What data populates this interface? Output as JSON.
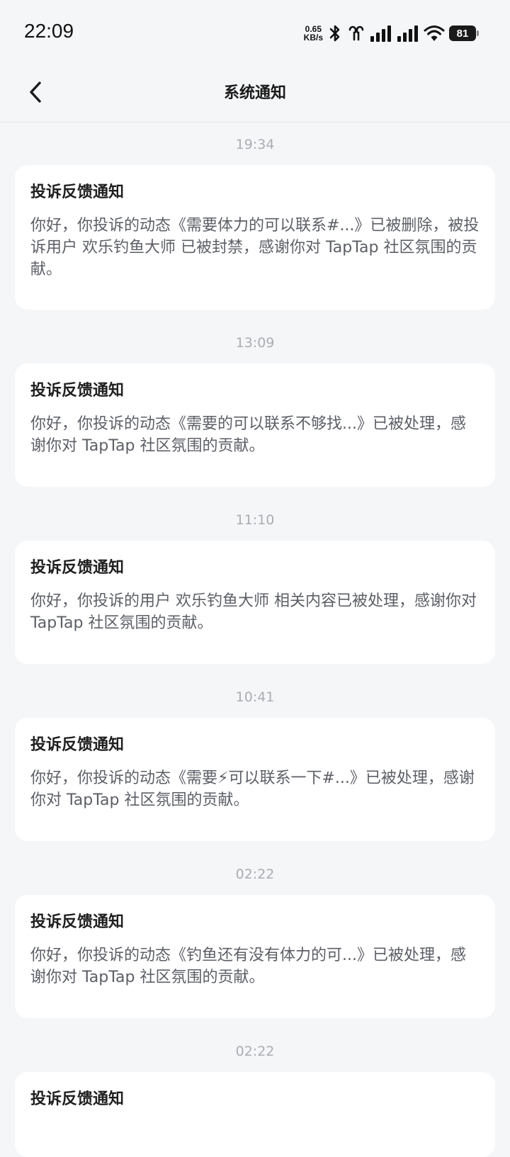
{
  "status_bar": {
    "time": "22:09",
    "net_speed_value": "0.65",
    "net_speed_unit": "KB/s",
    "battery_level": "81"
  },
  "nav": {
    "back_icon": "chevron-left-icon",
    "title": "系统通知"
  },
  "notifications": [
    {
      "time": "19:34",
      "title": "投诉反馈通知",
      "body": "你好，你投诉的动态《需要体力的可以联系#...》已被删除，被投诉用户 欢乐钓鱼大师 已被封禁，感谢你对 TapTap 社区氛围的贡献。"
    },
    {
      "time": "13:09",
      "title": "投诉反馈通知",
      "body": "你好，你投诉的动态《需要的可以联系不够找...》已被处理，感谢你对 TapTap 社区氛围的贡献。"
    },
    {
      "time": "11:10",
      "title": "投诉反馈通知",
      "body": "你好，你投诉的用户 欢乐钓鱼大师 相关内容已被处理，感谢你对 TapTap 社区氛围的贡献。"
    },
    {
      "time": "10:41",
      "title": "投诉反馈通知",
      "body": "你好，你投诉的动态《需要⚡可以联系一下#...》已被处理，感谢你对 TapTap 社区氛围的贡献。"
    },
    {
      "time": "02:22",
      "title": "投诉反馈通知",
      "body": "你好，你投诉的动态《钓鱼还有没有体力的可...》已被处理，感谢你对 TapTap 社区氛围的贡献。"
    },
    {
      "time": "02:22",
      "title": "投诉反馈通知",
      "body": ""
    }
  ]
}
